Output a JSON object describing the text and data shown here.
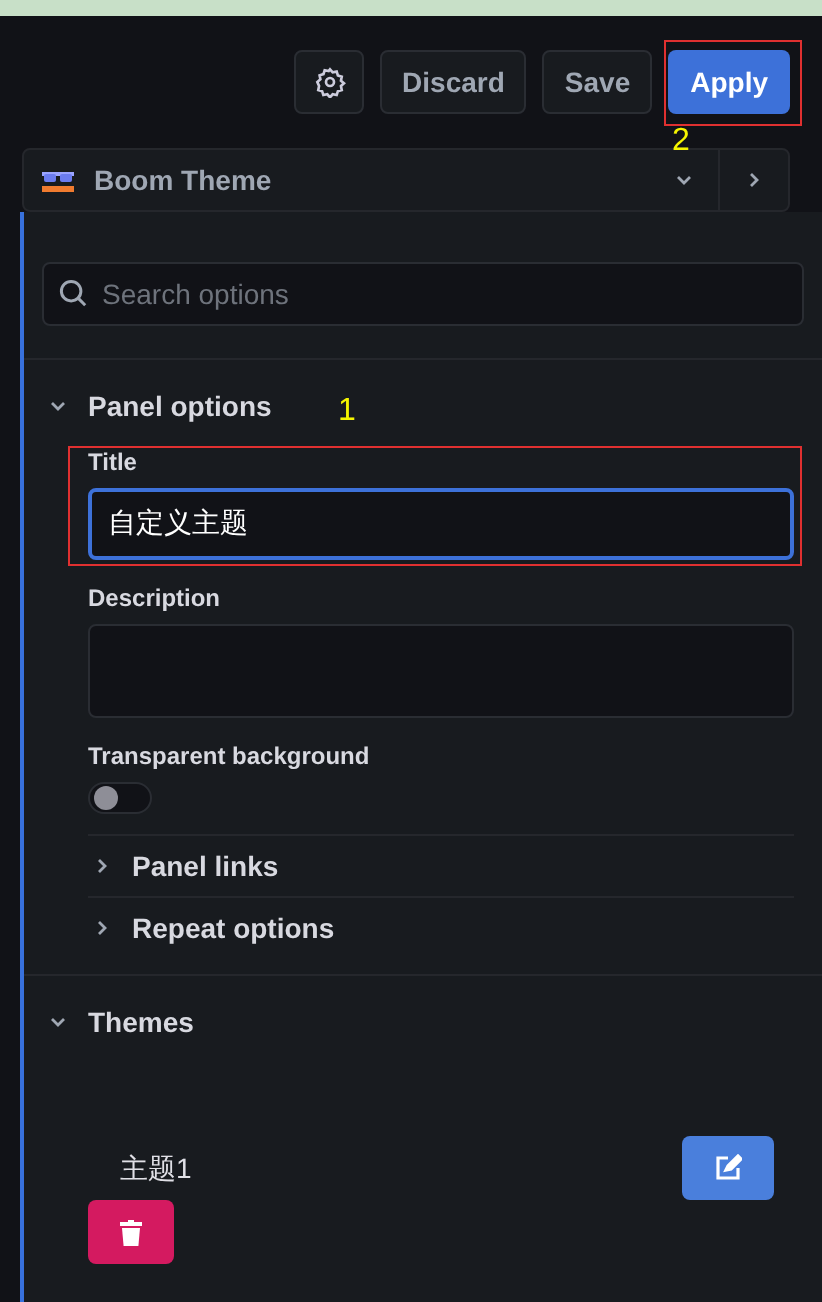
{
  "toolbar": {
    "buttons": [
      {
        "label": "Discard",
        "kind": "secondary"
      },
      {
        "label": "Save",
        "kind": "secondary"
      },
      {
        "label": "Apply",
        "kind": "primary"
      }
    ]
  },
  "visualization": {
    "name": "Boom Theme"
  },
  "search": {
    "placeholder": "Search options"
  },
  "sections": [
    {
      "title": "Panel options",
      "expanded": true,
      "fields": [
        {
          "kind": "text",
          "label": "Title",
          "value": "自定义主题",
          "focused": true
        },
        {
          "kind": "textarea",
          "label": "Description"
        },
        {
          "kind": "switch",
          "label": "Transparent background",
          "on": false
        }
      ],
      "subsections": [
        {
          "title": "Panel links",
          "expanded": false
        },
        {
          "title": "Repeat options",
          "expanded": false
        }
      ]
    },
    {
      "title": "Themes",
      "expanded": true,
      "themes": [
        {
          "name": "主题1"
        }
      ]
    }
  ],
  "annotations": [
    {
      "label": "1"
    },
    {
      "label": "2"
    }
  ]
}
